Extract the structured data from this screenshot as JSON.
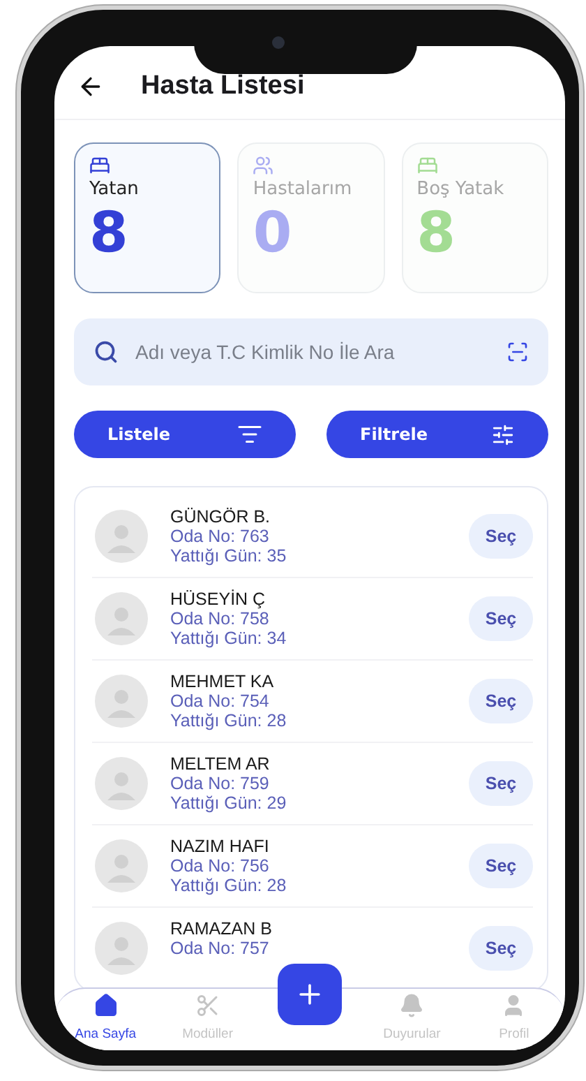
{
  "header": {
    "title": "Hasta Listesi"
  },
  "stats": [
    {
      "label": "Yatan",
      "value": "8",
      "selected": true,
      "color": "#3340d6"
    },
    {
      "label": "Hastalarım",
      "value": "0",
      "selected": false,
      "color": "#a9acf2"
    },
    {
      "label": "Boş Yatak",
      "value": "8",
      "selected": false,
      "color": "#a3dc93"
    }
  ],
  "search": {
    "placeholder": "Adı veya T.C Kimlik No İle Ara"
  },
  "actions": [
    "Listele",
    "Filtrele"
  ],
  "patients": [
    {
      "name": "GÜNGÖR B.",
      "room": "Oda No: 763",
      "days": "Yattığı Gün: 35",
      "button": "Seç"
    },
    {
      "name": "HÜSEYİN Ç",
      "room": "Oda No: 758",
      "days": "Yattığı Gün: 34",
      "button": "Seç"
    },
    {
      "name": "MEHMET KA",
      "room": "Oda No: 754",
      "days": "Yattığı Gün: 28",
      "button": "Seç"
    },
    {
      "name": "MELTEM AR",
      "room": "Oda No: 759",
      "days": "Yattığı Gün: 29",
      "button": "Seç"
    },
    {
      "name": "NAZIM HAFI",
      "room": "Oda No: 756",
      "days": "Yattığı Gün: 28",
      "button": "Seç"
    },
    {
      "name": "RAMAZAN B",
      "room": "Oda No: 757",
      "button": "Seç"
    }
  ],
  "nav": [
    {
      "label": "Ana Sayfa",
      "kind": "tab",
      "selected": true
    },
    {
      "label": "Modüller",
      "kind": "tab",
      "selected": false
    },
    {
      "kind": "add"
    },
    {
      "label": "Duyurular",
      "kind": "tab",
      "selected": false
    },
    {
      "label": "Profil",
      "kind": "tab",
      "selected": false
    }
  ]
}
